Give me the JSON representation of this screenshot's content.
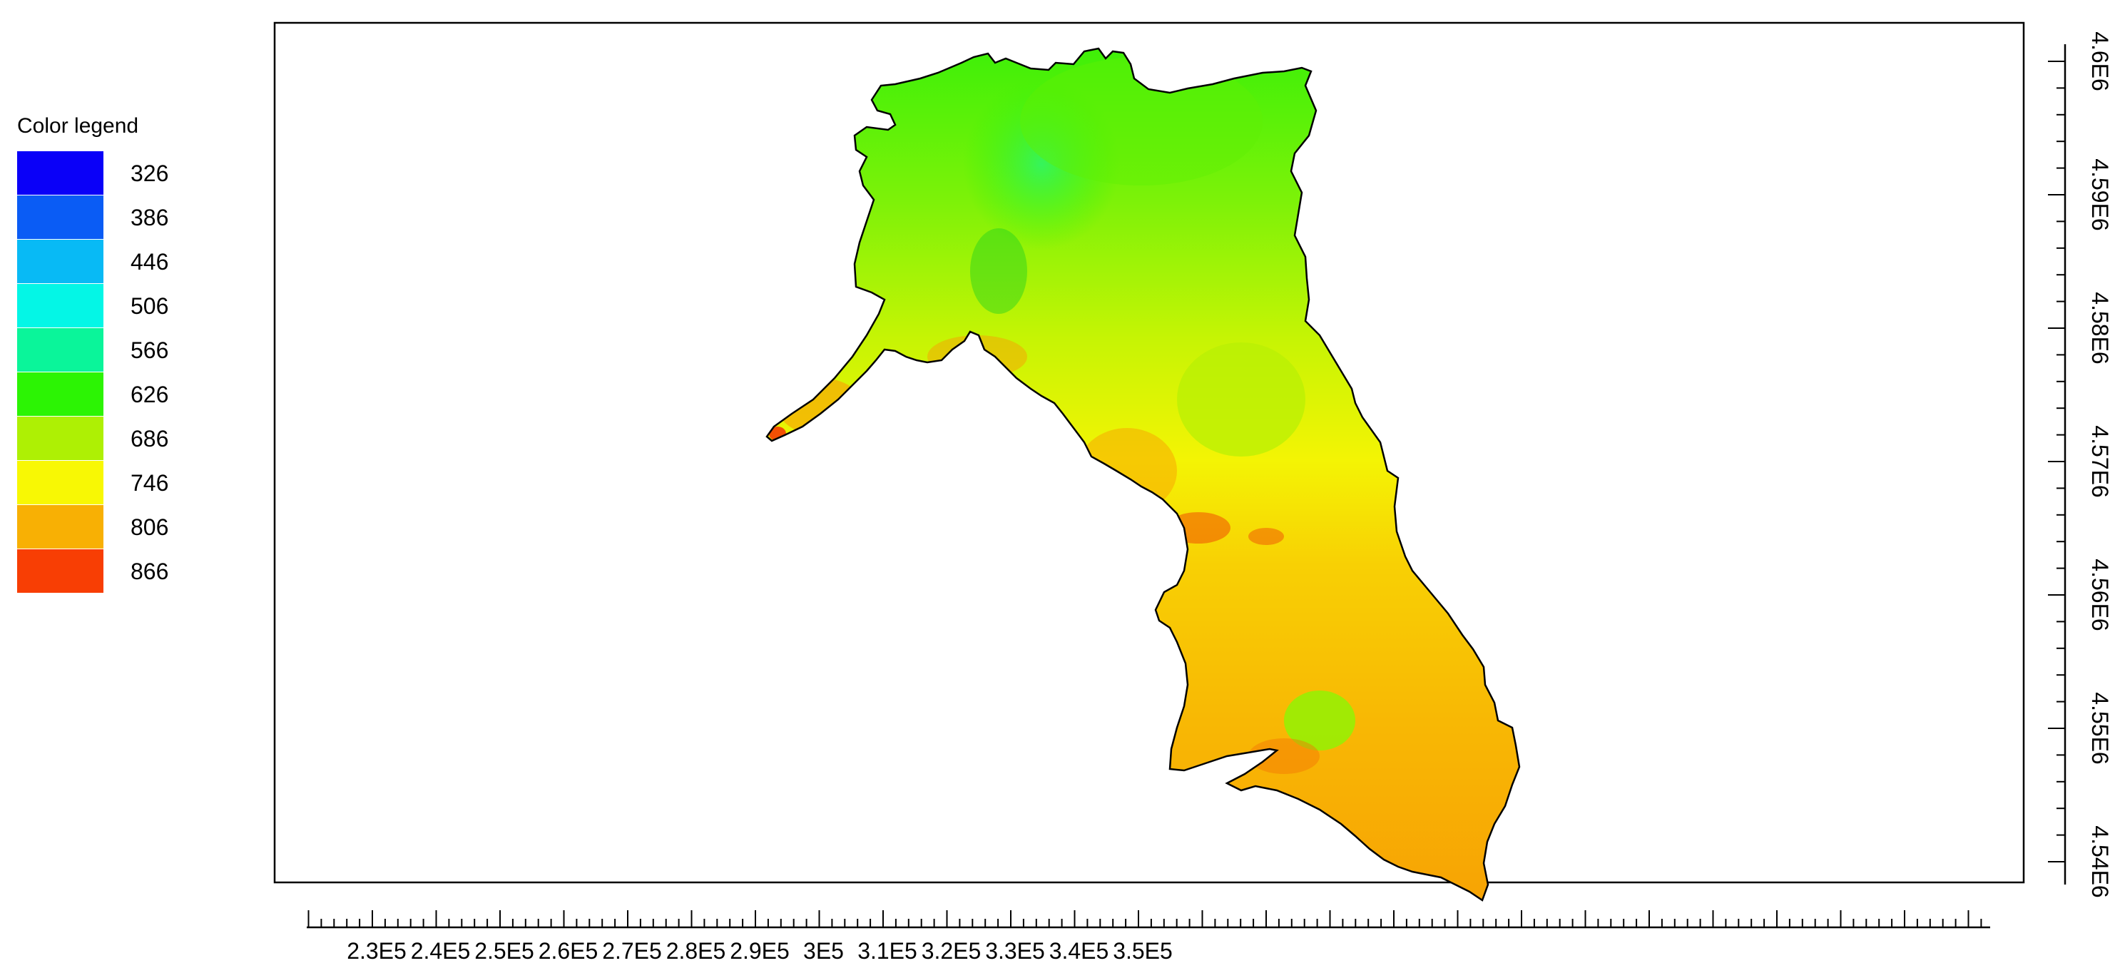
{
  "legend": {
    "title": "Color legend",
    "items": [
      {
        "value": "326",
        "color": "#0a00f8"
      },
      {
        "value": "386",
        "color": "#0a5cf5"
      },
      {
        "value": "446",
        "color": "#08baf5"
      },
      {
        "value": "506",
        "color": "#04f6e6"
      },
      {
        "value": "566",
        "color": "#0af59a"
      },
      {
        "value": "626",
        "color": "#2cf404"
      },
      {
        "value": "686",
        "color": "#aef004"
      },
      {
        "value": "746",
        "color": "#f8f804"
      },
      {
        "value": "806",
        "color": "#f8b004"
      },
      {
        "value": "866",
        "color": "#f83e04"
      }
    ]
  },
  "axes": {
    "x_ticks": [
      "2.3E5",
      "2.4E5",
      "2.5E5",
      "2.6E5",
      "2.7E5",
      "2.8E5",
      "2.9E5",
      "3E5",
      "3.1E5",
      "3.2E5",
      "3.3E5",
      "3.4E5",
      "3.5E5"
    ],
    "y_ticks": [
      "4.6E6",
      "4.59E6",
      "4.58E6",
      "4.57E6",
      "4.56E6",
      "4.55E6",
      "4.54E6"
    ]
  },
  "map": {
    "boundary_color": "#000000",
    "region_colors": [
      "#2cf404",
      "#aef004",
      "#f8f804",
      "#f8b004",
      "#f83e04"
    ]
  }
}
